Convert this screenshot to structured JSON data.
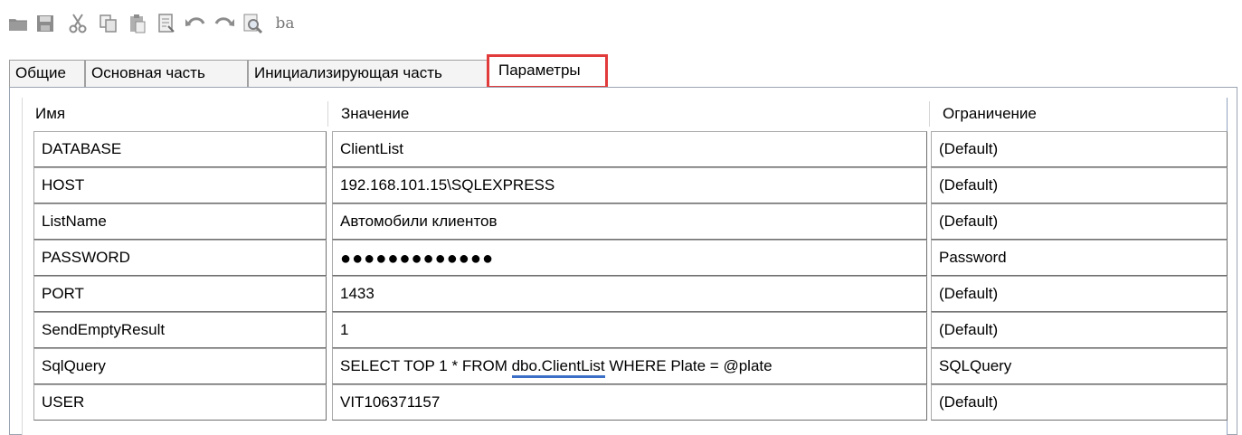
{
  "toolbar": {
    "buttons": [
      {
        "icon": "folder-open-icon"
      },
      {
        "icon": "save-icon"
      },
      {
        "icon": "cut-icon"
      },
      {
        "icon": "copy-icon"
      },
      {
        "icon": "paste-icon"
      },
      {
        "icon": "properties-icon"
      },
      {
        "icon": "undo-icon"
      },
      {
        "icon": "redo-icon"
      },
      {
        "icon": "find-icon"
      },
      {
        "icon": "replace-icon",
        "text": "ba"
      }
    ]
  },
  "tabs": [
    "Общие",
    "Основная часть",
    "Инициализирующая часть",
    "Параметры"
  ],
  "active_tab": "Параметры",
  "colors": {
    "highlight": "#e23b3b",
    "underline": "#3b6fc7"
  },
  "table": {
    "columns": [
      "Имя",
      "Значение",
      "Ограничение"
    ],
    "rows": [
      {
        "name": "DATABASE",
        "value": "ClientList",
        "restriction": "(Default)"
      },
      {
        "name": "HOST",
        "value": "192.168.101.15\\SQLEXPRESS",
        "restriction": "(Default)"
      },
      {
        "name": "ListName",
        "value": "Автомобили клиентов",
        "restriction": "(Default)"
      },
      {
        "name": "PASSWORD",
        "value": "●●●●●●●●●●●●●",
        "restriction": "Password"
      },
      {
        "name": "PORT",
        "value": "1433",
        "restriction": "(Default)"
      },
      {
        "name": "SendEmptyResult",
        "value": "1",
        "restriction": "(Default)"
      },
      {
        "name": "SqlQuery",
        "value_parts": [
          "SELECT TOP 1 * FROM ",
          "dbo.ClientList",
          " WHERE Plate = @plate"
        ],
        "restriction": "SQLQuery"
      },
      {
        "name": "USER",
        "value": "VIT106371157",
        "restriction": "(Default)"
      }
    ]
  }
}
